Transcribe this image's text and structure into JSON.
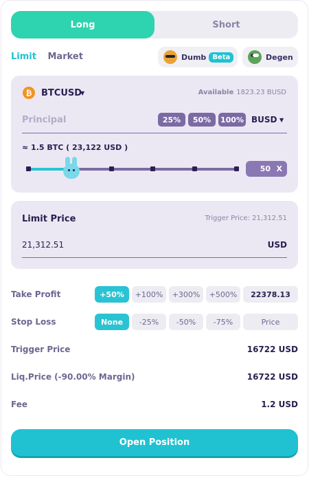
{
  "side_tabs": {
    "long": "Long",
    "short": "Short"
  },
  "order_type": {
    "limit": "Limit",
    "market": "Market"
  },
  "modes": {
    "dumb": "Dumb",
    "beta": "Beta",
    "degen": "Degen"
  },
  "order": {
    "pair": "BTCUSD",
    "available_label": "Available",
    "available_value": "1823.23 BUSD",
    "principal_placeholder": "Principal",
    "percent_buttons": [
      "25%",
      "50%",
      "100%"
    ],
    "currency": "BUSD",
    "approx": "≈ 1.5 BTC ( 23,122 USD )",
    "leverage_value": "50",
    "leverage_close": "X",
    "slider_fraction": 0.21
  },
  "limit_price": {
    "title": "Limit Price",
    "trigger": "Trigger Price: 21,312.51",
    "value": "21,312.51",
    "unit": "USD"
  },
  "take_profit": {
    "label": "Take Profit",
    "options": [
      "+50%",
      "+100%",
      "+300%",
      "+500%"
    ],
    "selected": "+50%",
    "value": "22378.13"
  },
  "stop_loss": {
    "label": "Stop Loss",
    "options": [
      "None",
      "-25%",
      "-50%",
      "-75%"
    ],
    "selected": "None",
    "price_placeholder": "Price"
  },
  "details": [
    {
      "label": "Trigger Price",
      "value": "16722 USD"
    },
    {
      "label": "Liq.Price (-90.00% Margin)",
      "value": "16722 USD"
    },
    {
      "label": "Fee",
      "value": "1.2 USD"
    }
  ],
  "open_position": "Open Position",
  "colors": {
    "long": "#2ed3b0",
    "accent": "#20c2d2",
    "card": "#ebe8f4",
    "primary_text": "#2a2050",
    "muted_text": "#6f6691"
  }
}
